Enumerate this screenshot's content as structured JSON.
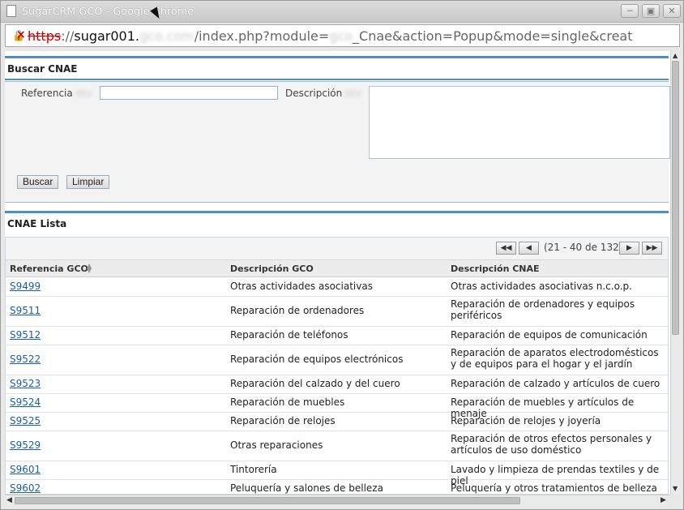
{
  "window": {
    "title": "SugarCRM GCO - Google Chrome"
  },
  "address_bar": {
    "scheme": "https",
    "host_prefix": "sugar001.",
    "host_blurred": "gco.com",
    "path_prefix": "/index.php?module=",
    "module_blurred": "gco",
    "path_suffix": "_Cnae&action=Popup&mode=single&creat"
  },
  "search": {
    "section_title": "Buscar CNAE",
    "referencia_label": "Referencia",
    "referencia_hint": "REV",
    "referencia_value": "",
    "descripcion_label": "Descripción",
    "descripcion_hint": "REV",
    "descripcion_value": "",
    "search_button": "Buscar",
    "clear_button": "Limpiar"
  },
  "list": {
    "section_title": "CNAE Lista",
    "pagination": "(21 - 40 de 132)",
    "columns": [
      "Referencia GCO",
      "Descripción GCO",
      "Descripción CNAE"
    ],
    "rows": [
      {
        "ref": "S9499",
        "gco": "Otras actividades asociativas",
        "cnae": "Otras actividades asociativas n.c.o.p."
      },
      {
        "ref": "S9511",
        "gco": "Reparación de ordenadores",
        "cnae": "Reparación de ordenadores y equipos periféricos"
      },
      {
        "ref": "S9512",
        "gco": "Reparación de teléfonos",
        "cnae": "Reparación de equipos de comunicación"
      },
      {
        "ref": "S9522",
        "gco": "Reparación de equipos electrónicos",
        "cnae": "Reparación de aparatos electrodomésticos y de equipos para el hogar y el jardín"
      },
      {
        "ref": "S9523",
        "gco": "Reparación del calzado y del cuero",
        "cnae": "Reparación de calzado y artículos de cuero"
      },
      {
        "ref": "S9524",
        "gco": "Reparación de muebles",
        "cnae": "Reparación de muebles y artículos de menaje"
      },
      {
        "ref": "S9525",
        "gco": "Reparación de relojes",
        "cnae": "Reparación de relojes y joyería"
      },
      {
        "ref": "S9529",
        "gco": "Otras reparaciones",
        "cnae": "Reparación de otros efectos personales y artículos de uso doméstico"
      },
      {
        "ref": "S9601",
        "gco": "Tintorería",
        "cnae": "Lavado y limpieza de prendas textiles y de piel"
      },
      {
        "ref": "S9602",
        "gco": "Peluquería y salones de belleza",
        "cnae": "Peluquería y otros tratamientos de belleza"
      }
    ]
  },
  "colors": {
    "accent": "#4d8fcb",
    "link": "#1a5da8",
    "panel": "#f3f3f3"
  }
}
